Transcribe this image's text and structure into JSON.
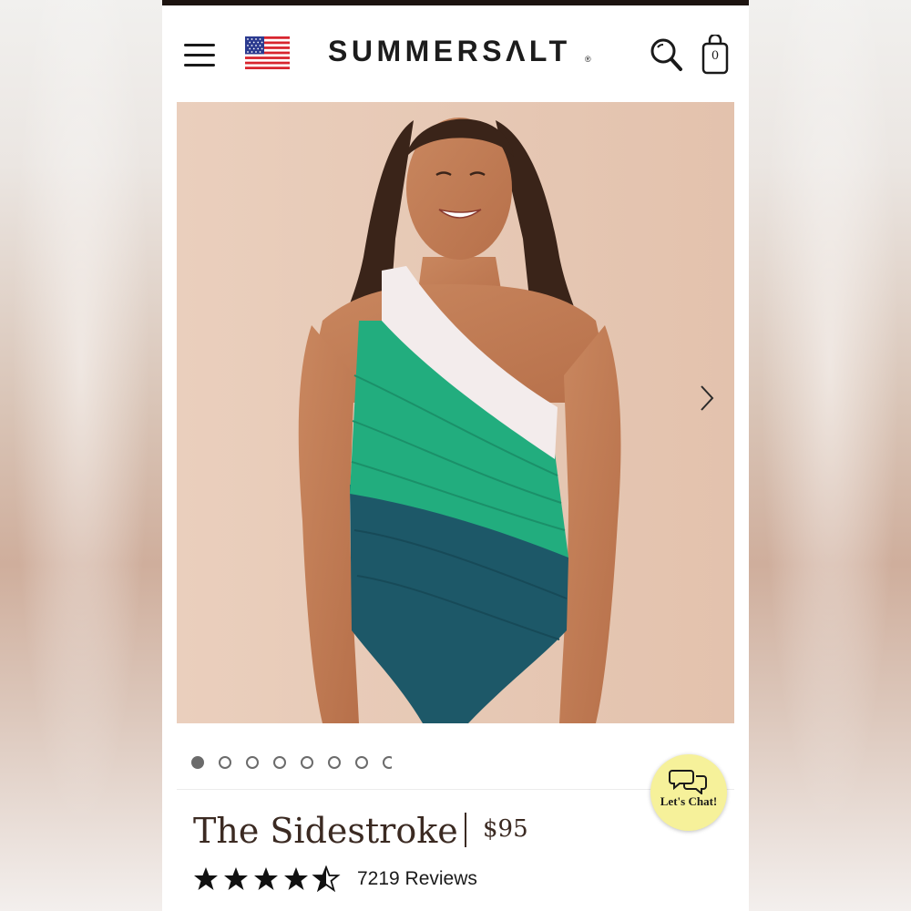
{
  "header": {
    "brand": "SUMMERSΛLT",
    "registered_mark": "®",
    "cart_count": "0",
    "region_flag": "us-flag-icon"
  },
  "product": {
    "title": "The Sidestroke",
    "price": "$95",
    "rating": 4.5,
    "rating_max": 5,
    "reviews_text": "7219 Reviews"
  },
  "gallery": {
    "visible_dots": 7,
    "active_index": 0,
    "next_icon": "chevron-right-icon"
  },
  "chat": {
    "label": "Let's Chat!",
    "color": "#f6f19a"
  },
  "colors": {
    "brand_text": "#1c1c1c",
    "title_text": "#3b2a22",
    "suit_white": "#f3ecec",
    "suit_green": "#22ad7e",
    "suit_teal": "#1d5868"
  }
}
